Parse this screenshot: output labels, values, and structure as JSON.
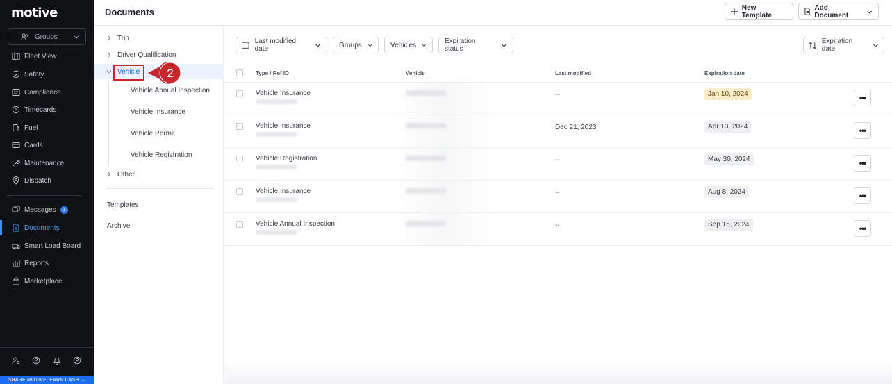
{
  "app": {
    "logo": "motive"
  },
  "sidebar": {
    "groups_label": "Groups",
    "items": [
      {
        "label": "Fleet View",
        "icon": "map-icon"
      },
      {
        "label": "Safety",
        "icon": "shield-icon"
      },
      {
        "label": "Compliance",
        "icon": "compliance-icon"
      },
      {
        "label": "Timecards",
        "icon": "clock-icon"
      },
      {
        "label": "Fuel",
        "icon": "fuel-icon"
      },
      {
        "label": "Cards",
        "icon": "card-icon"
      },
      {
        "label": "Maintenance",
        "icon": "wrench-icon"
      },
      {
        "label": "Dispatch",
        "icon": "dispatch-icon"
      }
    ],
    "items2": [
      {
        "label": "Messages",
        "icon": "messages-icon",
        "badge": "1"
      },
      {
        "label": "Documents",
        "icon": "document-icon",
        "active": true
      },
      {
        "label": "Smart Load Board",
        "icon": "load-board-icon"
      },
      {
        "label": "Reports",
        "icon": "reports-icon"
      },
      {
        "label": "Marketplace",
        "icon": "bag-icon"
      }
    ],
    "share_label": "SHARE MOTIVE, EARN CASH →"
  },
  "header": {
    "title": "Documents",
    "new_template": "New Template",
    "add_document": "Add Document"
  },
  "tree": {
    "trip": "Trip",
    "driver_qualification": "Driver Qualification",
    "vehicle": "Vehicle",
    "vehicle_children": [
      "Vehicle Annual Inspection",
      "Vehicle Insurance",
      "Vehicle Permit",
      "Vehicle Registration"
    ],
    "other": "Other",
    "templates": "Templates",
    "archive": "Archive"
  },
  "callout": {
    "number": "2",
    "color": "#c8272e"
  },
  "filters": {
    "last_modified": "Last modified date",
    "groups": "Groups",
    "vehicles": "Vehicles",
    "expiration_status": "Expiration status",
    "sort": "Expiration date"
  },
  "table": {
    "headers": {
      "type": "Type / Ref ID",
      "vehicle": "Vehicle",
      "modified": "Last modified",
      "expiration": "Expiration date"
    },
    "rows": [
      {
        "type": "Vehicle Insurance",
        "modified": "--",
        "expiration": "Jan 10, 2024",
        "warn": true
      },
      {
        "type": "Vehicle Insurance",
        "modified": "Dec 21, 2023",
        "expiration": "Apr 13, 2024"
      },
      {
        "type": "Vehicle Registration",
        "modified": "--",
        "expiration": "May 30, 2024"
      },
      {
        "type": "Vehicle Insurance",
        "modified": "--",
        "expiration": "Aug 8, 2024"
      },
      {
        "type": "Vehicle Annual Inspection",
        "modified": "--",
        "expiration": "Sep 15, 2024"
      }
    ],
    "more_label": "•••"
  }
}
